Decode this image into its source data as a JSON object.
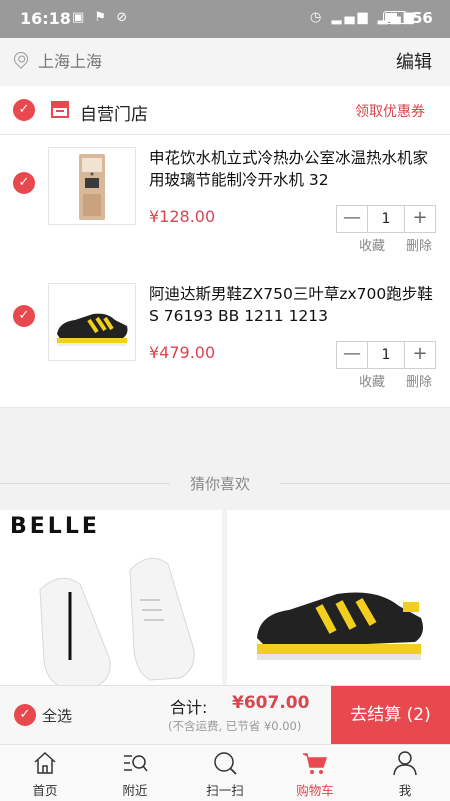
{
  "status_bar": {
    "time": "16:18",
    "battery": "56"
  },
  "header": {
    "location": "上海上海",
    "edit_label": "编辑"
  },
  "store": {
    "name": "自营门店",
    "coupon_label": "领取优惠券"
  },
  "cart_items": [
    {
      "title": "申花饮水机立式冷热办公室冰温热水机家用玻璃节能制冷开水机 32",
      "price": "¥128.00",
      "quantity": "1",
      "favorite_label": "收藏",
      "delete_label": "删除"
    },
    {
      "title": "阿迪达斯男鞋ZX750三叶草zx700跑步鞋S 76193 BB 1211 1213",
      "price": "¥479.00",
      "quantity": "1",
      "favorite_label": "收藏",
      "delete_label": "删除"
    }
  ],
  "recommend": {
    "heading": "猜你喜欢",
    "brand_logo": "BELLE"
  },
  "checkout": {
    "select_all_label": "全选",
    "total_label": "合计:",
    "total_value": "¥607.00",
    "note": "(不含运费, 已节省 ¥0.00)",
    "pay_label": "去结算 (2)"
  },
  "tabs": [
    {
      "label": "首页",
      "icon": "home-icon"
    },
    {
      "label": "附近",
      "icon": "nearby-icon"
    },
    {
      "label": "扫一扫",
      "icon": "scan-icon"
    },
    {
      "label": "购物车",
      "icon": "cart-icon",
      "active": true
    },
    {
      "label": "我",
      "icon": "profile-icon"
    }
  ],
  "colors": {
    "accent": "#e8494e",
    "price": "#d9464e"
  }
}
